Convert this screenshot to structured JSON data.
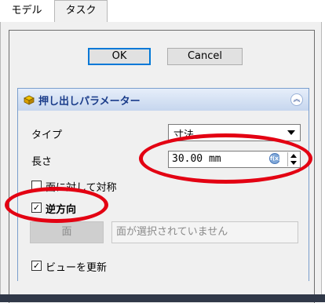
{
  "tabs": [
    {
      "label": "モデル",
      "active": false
    },
    {
      "label": "タスク",
      "active": true
    }
  ],
  "dialog": {
    "ok_label": "OK",
    "cancel_label": "Cancel"
  },
  "section": {
    "icon": "extrude-icon",
    "title": "押し出しパラメーター",
    "collapse_icon": "collapse-up-icon"
  },
  "fields": {
    "type_label": "タイプ",
    "type_value": "寸法",
    "length_label": "長さ",
    "length_value": "30.00 mm",
    "symmetric_label": "面に対して対称",
    "symmetric_checked": false,
    "reversed_label": "逆方向",
    "reversed_checked": true,
    "face_button_label": "面",
    "face_placeholder": "面が選択されていません",
    "update_view_label": "ビューを更新",
    "update_view_checked": true
  },
  "annotation_color": "#e30012"
}
